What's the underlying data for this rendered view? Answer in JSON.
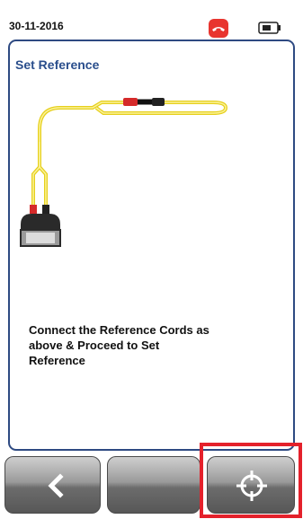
{
  "status_bar": {
    "date": "30-11-2016",
    "icons": [
      "phone-hangup-icon",
      "battery-icon"
    ],
    "phone_color": "#e8352f"
  },
  "panel": {
    "title": "Set Reference",
    "instructions": "Connect the Reference Cords as\nabove & Proceed to Set\nReference",
    "diagram": {
      "cord_color": "#f0e226",
      "connector_colors": [
        "#d52a2a",
        "#111111"
      ],
      "icons": [
        "tester-device-icon",
        "reference-cord-connector-icon"
      ]
    }
  },
  "nav": {
    "back_icon": "chevron-left-icon",
    "middle_button": "",
    "reference_icon": "crosshair-target-icon",
    "highlighted": "set-reference-button",
    "highlight_color": "#e4212b"
  },
  "colors": {
    "accent": "#2e4a82",
    "title": "#2a4e8c"
  }
}
